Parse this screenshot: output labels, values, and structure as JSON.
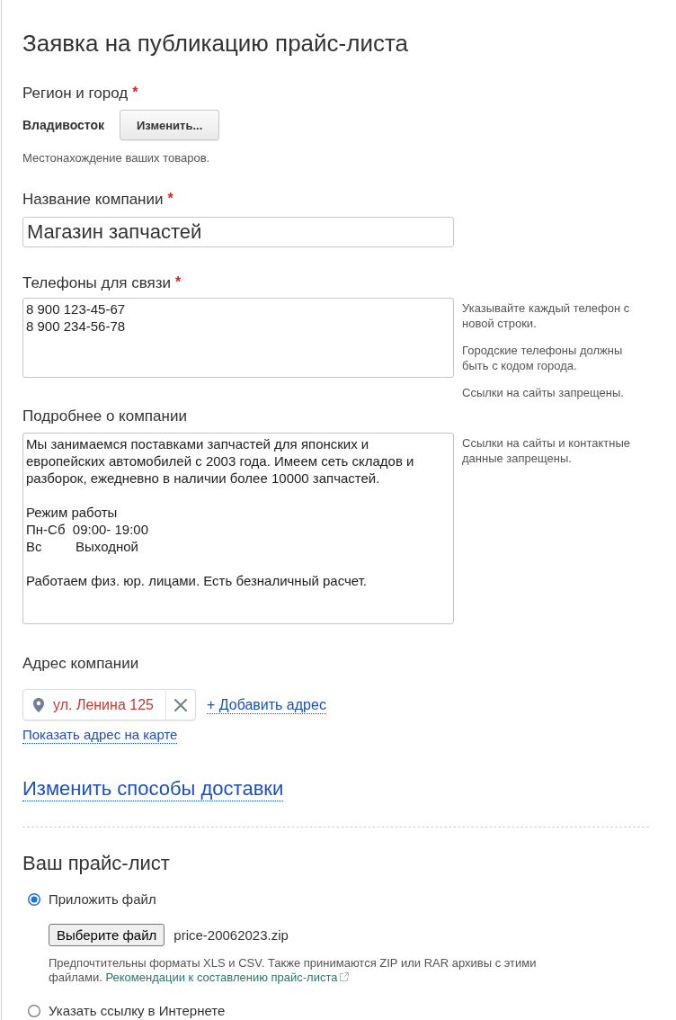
{
  "title": "Заявка на публикацию прайс-листа",
  "region": {
    "label": "Регион и город",
    "required_mark": "*",
    "city": "Владивосток",
    "button": "Изменить...",
    "hint": "Местонахождение ваших товаров."
  },
  "company_name": {
    "label": "Название компании",
    "required_mark": "*",
    "value": "Магазин запчастей"
  },
  "phones": {
    "label": "Телефоны для связи",
    "required_mark": "*",
    "value": "8 900 123-45-67\n8 900 234-56-78",
    "hints": [
      "Указывайте каждый телефон с новой строки.",
      "Городские телефоны должны быть с кодом города.",
      "Ссылки на сайты запрещены."
    ]
  },
  "about": {
    "label": "Подробнее о компании",
    "value": "Мы занимаемся поставками запчастей для японских и европейских автомобилей с 2003 года. Имеем сеть складов и разборок, ежедневно в наличии более 10000 запчастей.\n\nРежим работы\nПн-Сб  09:00- 19:00\nВс         Выходной\n\nРаботаем физ. юр. лицами. Есть безналичный расчет.",
    "hints": [
      "Ссылки на сайты и контактные данные запрещены."
    ]
  },
  "address": {
    "label": "Адрес компании",
    "items": [
      {
        "text": "ул. Ленина 125"
      }
    ],
    "add_link": "+ Добавить адрес",
    "map_link": "Показать адрес на карте"
  },
  "delivery_link": "Изменить способы доставки",
  "price_list": {
    "title": "Ваш прайс-лист",
    "options": [
      {
        "label": "Приложить файл",
        "selected": true,
        "file": {
          "button": "Выберите файл",
          "name": "price-20062023.zip"
        },
        "hint": "Предпочтительны форматы XLS и CSV. Также принимаются ZIP или RAR архивы с этими файлами.",
        "hint_link": "Рекомендации к составлению прайс-листа"
      },
      {
        "label": "Указать ссылку в Интернете",
        "selected": false
      }
    ]
  }
}
